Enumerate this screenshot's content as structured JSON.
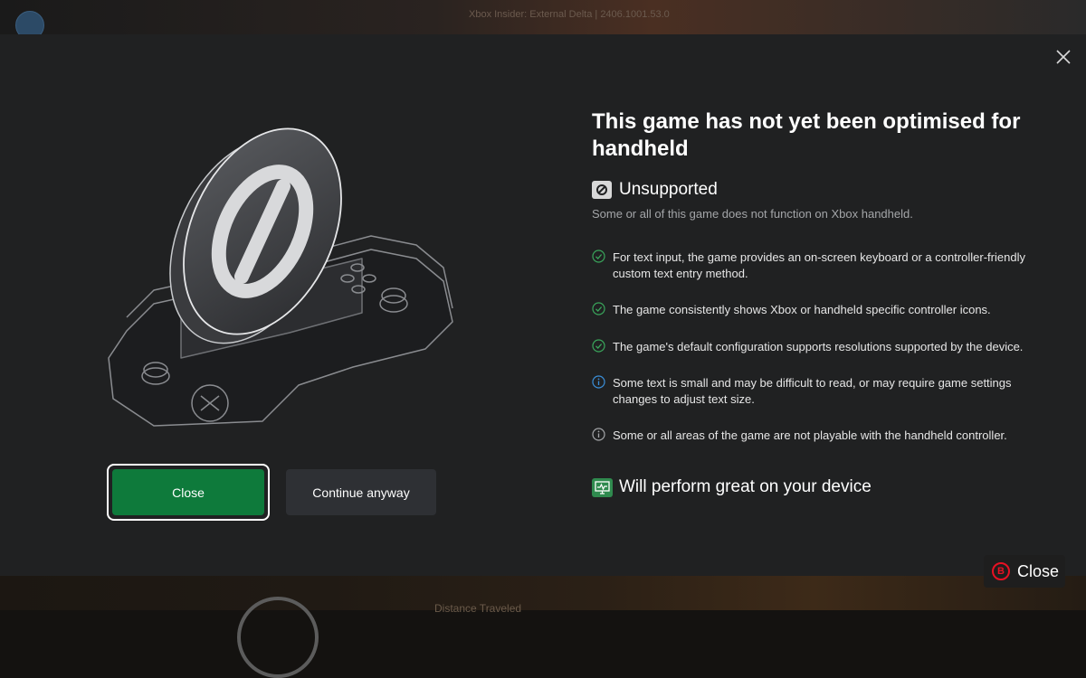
{
  "background": {
    "header_text": "Xbox Insider: External Delta  |  2406.1001.53.0",
    "bottom_text": "Distance Traveled"
  },
  "dialog": {
    "title": "This game has not yet been optimised for handheld",
    "status": {
      "icon": "unsupported-icon",
      "label": "Unsupported",
      "description": "Some or all of this game does not function on Xbox handheld."
    },
    "criteria": [
      {
        "icon": "check-circle-icon",
        "status": "pass",
        "text": "For text input, the game provides an on-screen keyboard or a controller-friendly custom text entry method."
      },
      {
        "icon": "check-circle-icon",
        "status": "pass",
        "text": "The game consistently shows Xbox or handheld specific controller icons."
      },
      {
        "icon": "check-circle-icon",
        "status": "pass",
        "text": "The game's default configuration supports resolutions supported by the device."
      },
      {
        "icon": "info-circle-icon",
        "status": "info",
        "text": "Some text is small and may be difficult to read, or may require game settings changes to adjust text size."
      },
      {
        "icon": "info-circle-icon",
        "status": "neutral",
        "text": "Some or all areas of the game are not playable with the handheld controller."
      }
    ],
    "performance": {
      "icon": "performance-icon",
      "label": "Will perform great on your device"
    },
    "buttons": {
      "close": "Close",
      "continue": "Continue anyway"
    }
  },
  "controller_hint": {
    "button": "B",
    "label": "Close"
  },
  "colors": {
    "dialog_bg": "#202122",
    "primary_button": "#0e7a3b",
    "secondary_button": "#2e3034",
    "pass": "#3aa55b",
    "info": "#3b8fd9",
    "hint_b": "#e81123"
  }
}
